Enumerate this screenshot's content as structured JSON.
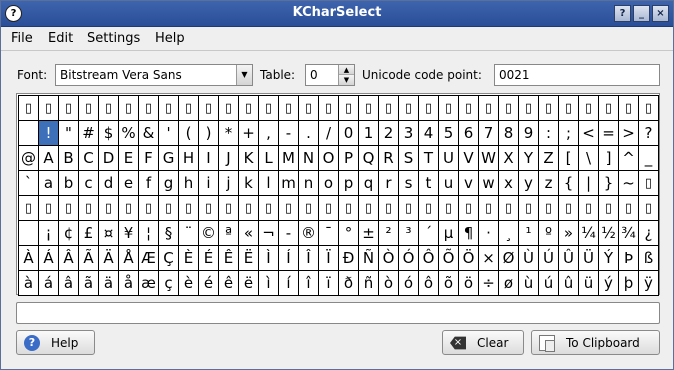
{
  "window": {
    "title": "KCharSelect"
  },
  "menu": [
    "File",
    "Edit",
    "Settings",
    "Help"
  ],
  "font": {
    "label": "Font:",
    "value": "Bitstream Vera Sans"
  },
  "table": {
    "label": "Table:",
    "value": "0"
  },
  "unicode": {
    "label": "Unicode code point:",
    "value": "0021"
  },
  "grid": {
    "rows": [
      [
        "▯",
        "▯",
        "▯",
        "▯",
        "▯",
        "▯",
        "▯",
        "▯",
        "▯",
        "▯",
        "▯",
        "▯",
        "▯",
        "▯",
        "▯",
        "▯",
        "▯",
        "▯",
        "▯",
        "▯",
        "▯",
        "▯",
        "▯",
        "▯",
        "▯",
        "▯",
        "▯",
        "▯",
        "▯",
        "▯",
        "▯",
        "▯"
      ],
      [
        " ",
        "!",
        "\"",
        "#",
        "$",
        "%",
        "&",
        "'",
        "(",
        ")",
        "*",
        "+",
        ",",
        "-",
        ".",
        "/",
        "0",
        "1",
        "2",
        "3",
        "4",
        "5",
        "6",
        "7",
        "8",
        "9",
        ":",
        ";",
        "<",
        "=",
        ">",
        "?"
      ],
      [
        "@",
        "A",
        "B",
        "C",
        "D",
        "E",
        "F",
        "G",
        "H",
        "I",
        "J",
        "K",
        "L",
        "M",
        "N",
        "O",
        "P",
        "Q",
        "R",
        "S",
        "T",
        "U",
        "V",
        "W",
        "X",
        "Y",
        "Z",
        "[",
        "\\",
        "]",
        "^",
        "_"
      ],
      [
        "`",
        "a",
        "b",
        "c",
        "d",
        "e",
        "f",
        "g",
        "h",
        "i",
        "j",
        "k",
        "l",
        "m",
        "n",
        "o",
        "p",
        "q",
        "r",
        "s",
        "t",
        "u",
        "v",
        "w",
        "x",
        "y",
        "z",
        "{",
        "|",
        "}",
        "~",
        "▯"
      ],
      [
        "▯",
        "▯",
        "▯",
        "▯",
        "▯",
        "▯",
        "▯",
        "▯",
        "▯",
        "▯",
        "▯",
        "▯",
        "▯",
        "▯",
        "▯",
        "▯",
        "▯",
        "▯",
        "▯",
        "▯",
        "▯",
        "▯",
        "▯",
        "▯",
        "▯",
        "▯",
        "▯",
        "▯",
        "▯",
        "▯",
        "▯",
        "▯"
      ],
      [
        " ",
        "¡",
        "¢",
        "£",
        "¤",
        "¥",
        "¦",
        "§",
        "¨",
        "©",
        "ª",
        "«",
        "¬",
        "-",
        "®",
        "¯",
        "°",
        "±",
        "²",
        "³",
        "´",
        "µ",
        "¶",
        "·",
        "¸",
        "¹",
        "º",
        "»",
        "¼",
        "½",
        "¾",
        "¿"
      ],
      [
        "À",
        "Á",
        "Â",
        "Ã",
        "Ä",
        "Å",
        "Æ",
        "Ç",
        "È",
        "É",
        "Ê",
        "Ë",
        "Ì",
        "Í",
        "Î",
        "Ï",
        "Ð",
        "Ñ",
        "Ò",
        "Ó",
        "Ô",
        "Õ",
        "Ö",
        "×",
        "Ø",
        "Ù",
        "Ú",
        "Û",
        "Ü",
        "Ý",
        "Þ",
        "ß"
      ],
      [
        "à",
        "á",
        "â",
        "ã",
        "ä",
        "å",
        "æ",
        "ç",
        "è",
        "é",
        "ê",
        "ë",
        "ì",
        "í",
        "î",
        "ï",
        "ð",
        "ñ",
        "ò",
        "ó",
        "ô",
        "õ",
        "ö",
        "÷",
        "ø",
        "ù",
        "ú",
        "û",
        "ü",
        "ý",
        "þ",
        "ÿ"
      ]
    ],
    "selected": {
      "row": 1,
      "col": 1
    }
  },
  "output": {
    "value": ""
  },
  "buttons": {
    "help": "Help",
    "clear": "Clear",
    "clipboard": "To Clipboard"
  },
  "colors": {
    "titlebar": "#2f57a3",
    "selection": "#3d70b8"
  }
}
